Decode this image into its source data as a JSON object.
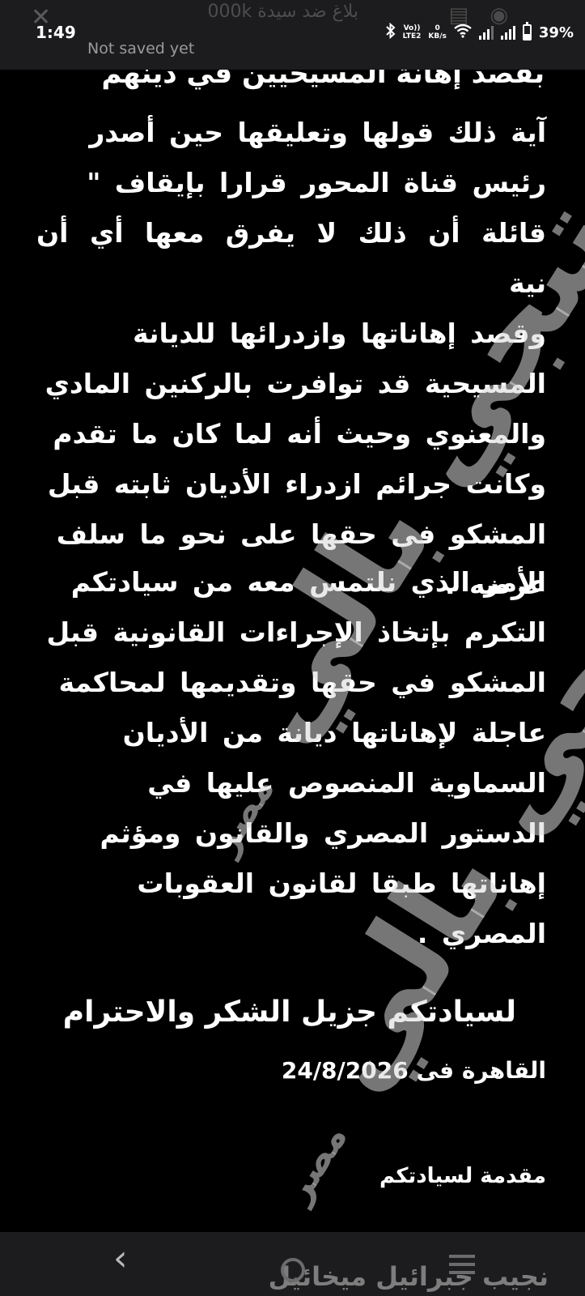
{
  "status": {
    "time": "1:49",
    "volte_top": "Vo))",
    "volte_bottom": "LTE2",
    "net_speed_value": "0",
    "net_speed_unit": "KB/s",
    "battery": "39%"
  },
  "app_bar": {
    "save_status": "Not saved yet",
    "ghost_title": "بلاغ ضد سيدة 000k"
  },
  "document": {
    "clipped_top_line": "بقصد إهانة المسيحيين في دينهم",
    "paragraph_1_lines": [
      "آية ذلك قولها وتعليقها حين أصدر",
      "رئيس قناة المحور قرارا بإيقاف \"",
      "قائلة أن ذلك لا يفرق معها أي أن نية",
      "وقصد إهاناتها وازدرائها للديانة",
      "المسيحية قد توافرت بالركنين المادي",
      "والمعنوي وحيث أنه لما كان ما تقدم",
      "وكانت جرائم ازدراء الأديان ثابته قبل",
      "المشكو فى حقها على نحو ما سلف",
      "عرضه ."
    ],
    "paragraph_2_lines": [
      "الأمر الذي نلتمس معه من سيادتكم",
      "التكرم بإتخاذ الإجراءات القانونية قبل",
      "المشكو في حقها وتقديمها لمحاكمة",
      "عاجلة لإهاناتها ديانة من الأديان",
      "السماوية المنصوص عليها في",
      "الدستور المصري والقانون ومؤثم",
      "إهاناتها طبقا لقانون العقوبات",
      "المصري ."
    ],
    "closing": "لسيادتكم جزيل الشكر والاحترام",
    "dateline": "القاهرة فى 24/8/2026",
    "presented_by": "مقدمة لسيادتكم"
  },
  "watermark": {
    "main_text": "تيجي بالي",
    "sub_text": "مصر"
  },
  "bottom_bar": {
    "signer": "نجيب جبرائيل ميخائيل"
  }
}
